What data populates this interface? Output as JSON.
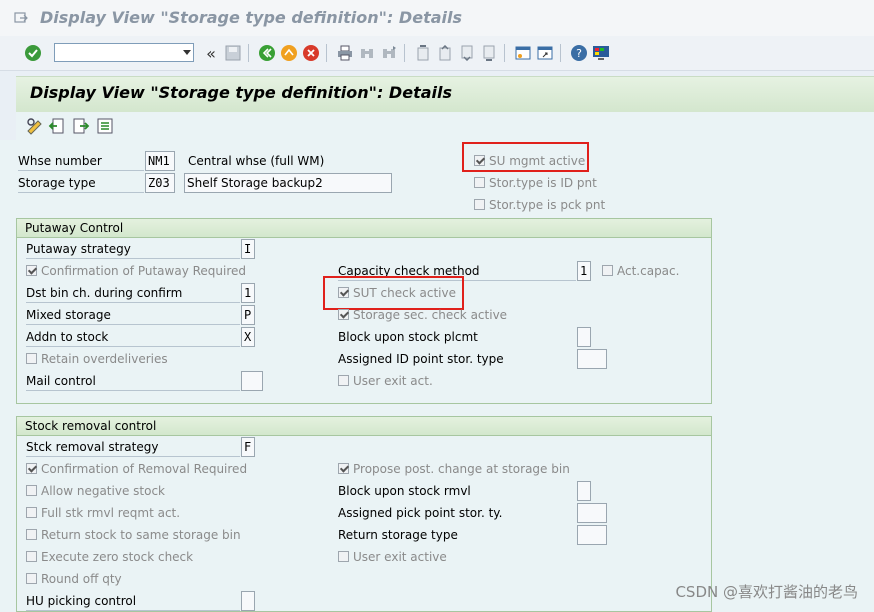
{
  "window": {
    "title": "Display View \"Storage type definition\": Details"
  },
  "toolbar": {
    "command_field_value": "",
    "icons": [
      "enter-icon",
      "back-nav-icon",
      "save-icon",
      "back-icon",
      "exit-icon",
      "cancel-icon",
      "print-icon",
      "find-icon",
      "find-next-icon",
      "first-page-icon",
      "prev-page-icon",
      "next-page-icon",
      "last-page-icon",
      "create-session-icon",
      "shortcut-icon",
      "help-icon",
      "customize-icon"
    ]
  },
  "page": {
    "header": "Display View \"Storage type definition\": Details"
  },
  "header_fields": {
    "whse_number": {
      "label": "Whse number",
      "value": "NM1",
      "desc": "Central whse (full WM)"
    },
    "storage_type": {
      "label": "Storage type",
      "value": "Z03",
      "desc": "Shelf Storage backup2"
    },
    "su_mgmt_active": {
      "label": "SU mgmt active",
      "checked": true
    },
    "stor_type_id_pnt": {
      "label": "Stor.type is ID pnt",
      "checked": false
    },
    "stor_type_pck_pnt": {
      "label": "Stor.type is pck pnt",
      "checked": false
    }
  },
  "putaway": {
    "title": "Putaway Control",
    "putaway_strategy": {
      "label": "Putaway strategy",
      "value": "I"
    },
    "confirmation_required": {
      "label": "Confirmation of Putaway Required",
      "checked": true
    },
    "dst_bin_change": {
      "label": "Dst bin ch. during confirm",
      "value": "1"
    },
    "mixed_storage": {
      "label": "Mixed storage",
      "value": "P"
    },
    "addn_to_stock": {
      "label": "Addn to stock",
      "value": "X"
    },
    "retain_overdeliveries": {
      "label": "Retain overdeliveries",
      "checked": false
    },
    "mail_control": {
      "label": "Mail control",
      "value": ""
    },
    "capacity_check_method": {
      "label": "Capacity check method",
      "value": "1"
    },
    "act_capac": {
      "label": "Act.capac.",
      "checked": false
    },
    "sut_check_active": {
      "label": "SUT check active",
      "checked": true
    },
    "storage_sec_check_active": {
      "label": "Storage sec. check active",
      "checked": true
    },
    "block_upon_stock_plcmt": {
      "label": "Block upon stock plcmt",
      "value": ""
    },
    "assigned_id_point": {
      "label": "Assigned ID point stor. type",
      "value": ""
    },
    "user_exit_act": {
      "label": "User exit act.",
      "checked": false
    }
  },
  "removal": {
    "title": "Stock removal control",
    "stck_removal_strategy": {
      "label": "Stck removal strategy",
      "value": "F"
    },
    "confirmation_removal_required": {
      "label": "Confirmation of Removal Required",
      "checked": true
    },
    "allow_negative_stock": {
      "label": "Allow negative stock",
      "checked": false
    },
    "full_stk_rmvl": {
      "label": "Full stk rmvl reqmt act.",
      "checked": false
    },
    "return_same_bin": {
      "label": "Return stock to same storage bin",
      "checked": false
    },
    "execute_zero_stock_check": {
      "label": "Execute zero stock check",
      "checked": false
    },
    "round_off_qty": {
      "label": "Round off qty",
      "checked": false
    },
    "hu_picking_control": {
      "label": "HU picking control",
      "value": ""
    },
    "propose_post_change": {
      "label": "Propose post. change at storage bin",
      "checked": true
    },
    "block_upon_stock_rmvl": {
      "label": "Block upon stock rmvl",
      "value": ""
    },
    "assigned_pick_point": {
      "label": "Assigned pick point stor. ty.",
      "value": ""
    },
    "return_storage_type": {
      "label": "Return storage type",
      "value": ""
    },
    "user_exit_active": {
      "label": "User exit active",
      "checked": false
    }
  },
  "watermark": "CSDN @喜欢打酱油的老鸟",
  "colors": {
    "highlight": "#e0201b",
    "group_border": "#a7c6a0",
    "background": "#eaf3f5"
  }
}
